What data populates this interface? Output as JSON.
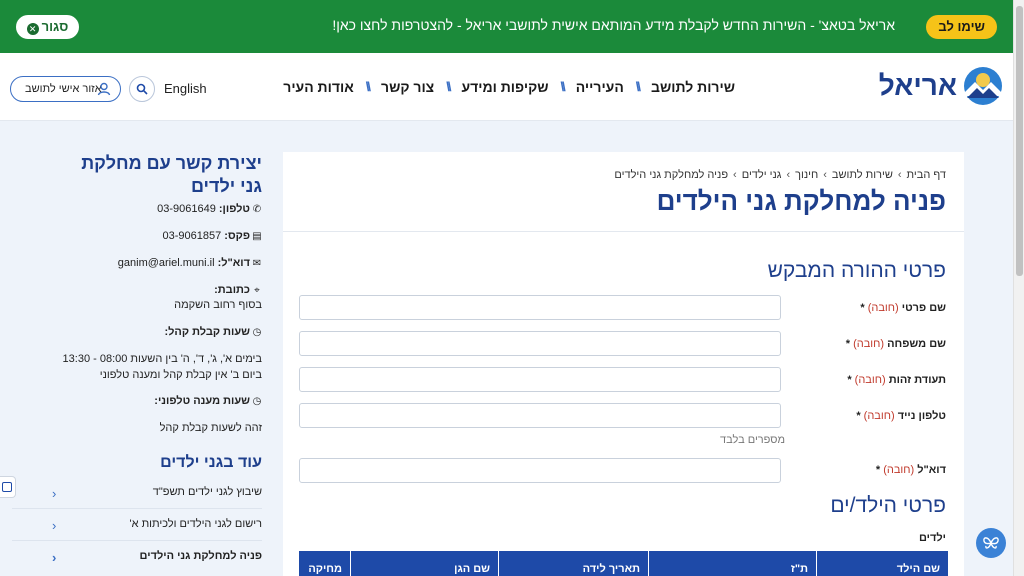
{
  "banner": {
    "notice_button": "שימו לב",
    "notice_text": "אריאל בטאצ' - השירות החדש לקבלת מידע המותאם אישית לתושבי אריאל - להצטרפות לחצו כאן!",
    "close_label": "סגור"
  },
  "header": {
    "logo_text": "אריאל",
    "nav": [
      "שירות לתושב",
      "העירייה",
      "שקיפות ומידע",
      "צור קשר",
      "אודות העיר"
    ],
    "language": "English",
    "personal_area": "אזור אישי לתושב"
  },
  "main": {
    "breadcrumbs": [
      "דף הבית",
      "שירות לתושב",
      "חינוך",
      "גני ילדים",
      "פניה למחלקת גני הילדים"
    ],
    "page_title": "פניה למחלקת גני הילדים",
    "parent_section_title": "פרטי ההורה המבקש",
    "required_note": "(חובה)",
    "fields": [
      {
        "label": "שם פרטי"
      },
      {
        "label": "שם משפחה"
      },
      {
        "label": "תעודת זהות"
      },
      {
        "label": "טלפון נייד",
        "hint": "מספרים בלבד"
      },
      {
        "label": "דוא\"ל"
      }
    ],
    "child_section_title": "פרטי הילד/ים",
    "children_label": "ילדים",
    "table_headers": [
      "שם הילד",
      "ת\"ז",
      "תאריך לידה",
      "שם הגן",
      "מחיקה"
    ]
  },
  "sidebar": {
    "contact_title": "יצירת קשר עם מחלקת גני ילדים",
    "phone_label": "טלפון:",
    "phone": "03-9061649",
    "fax_label": "פקס:",
    "fax": "03-9061857",
    "email_label": "דוא\"ל:",
    "email": "ganim@ariel.muni.il",
    "address_label": "כתובת:",
    "address": "בסוף רחוב השקמה",
    "reception_label": "שעות קבלת קהל:",
    "reception_line1": "בימים א', ג', ד', ה' בין השעות 08:00 - 13:30",
    "reception_line2": "ביום ב' אין קבלת קהל ומענה טלפוני",
    "phone_hours_label": "שעות מענה טלפוני:",
    "phone_hours": "זהה לשעות קבלת קהל",
    "more_title": "עוד בגני ילדים",
    "links": [
      "שיבוץ לגני ילדים תשפ\"ד",
      "רישום לגני הילדים ולכיתות א'",
      "פניה למחלקת גני הילדים"
    ]
  },
  "colors": {
    "banner_green": "#1b8a3a",
    "notice_yellow": "#f6c318",
    "brand_blue": "#1e3f8c",
    "table_header_blue": "#1e4aa8"
  }
}
